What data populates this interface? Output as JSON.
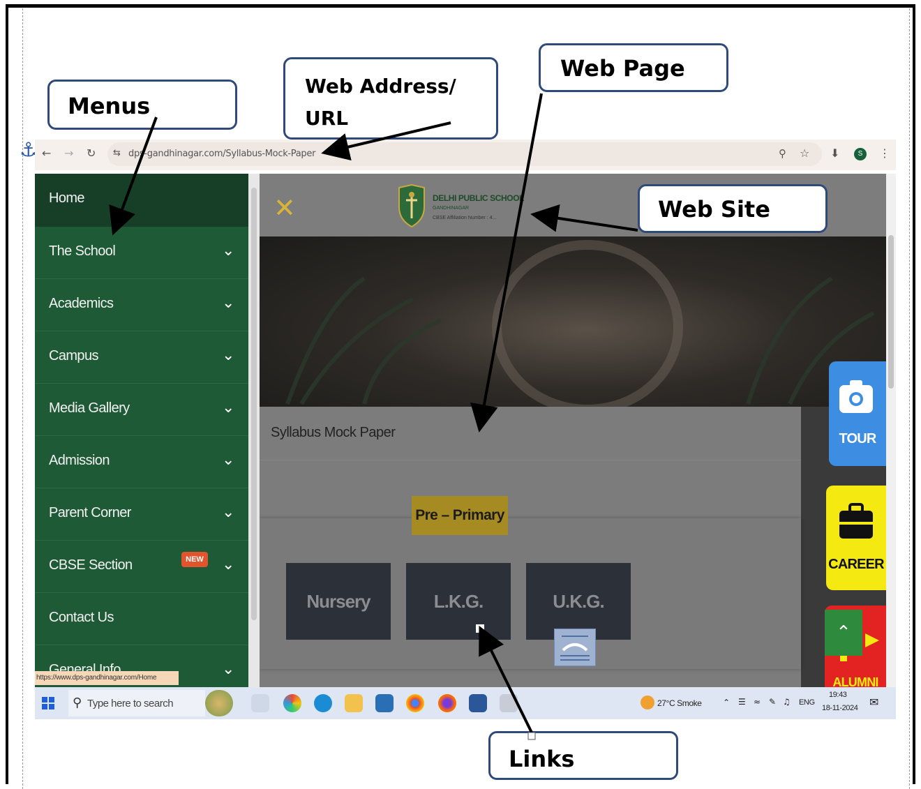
{
  "callouts": {
    "menus": "Menus",
    "web_address_line1": "Web Address/",
    "web_address_line2": "URL",
    "web_page": "Web Page",
    "web_site": "Web Site",
    "links": "Links"
  },
  "browser": {
    "url": "dps-gandhinagar.com/Syllabus-Mock-Paper",
    "status_url": "https://www.dps-gandhinagar.com/Home",
    "profile_initial": "S"
  },
  "sidebar": {
    "items": [
      {
        "label": "Home",
        "has_chevron": false
      },
      {
        "label": "The School",
        "has_chevron": true
      },
      {
        "label": "Academics",
        "has_chevron": true
      },
      {
        "label": "Campus",
        "has_chevron": true
      },
      {
        "label": "Media Gallery",
        "has_chevron": true
      },
      {
        "label": "Admission",
        "has_chevron": true
      },
      {
        "label": "Parent Corner",
        "has_chevron": true
      },
      {
        "label": "CBSE Section",
        "has_chevron": true,
        "badge": "NEW"
      },
      {
        "label": "Contact Us",
        "has_chevron": false
      },
      {
        "label": "General Info",
        "has_chevron": true
      }
    ]
  },
  "site": {
    "school_name": "DELHI PUBLIC SCHOOL",
    "school_sub": "GANDHINAGAR",
    "affiliation": "CBSE Affiliation Number : 4...",
    "page_title": "Syllabus Mock Paper",
    "category": "Pre – Primary",
    "classes": [
      "Nursery",
      "L.K.G.",
      "U.K.G."
    ],
    "accent_color": "#a68a22",
    "header_close_color": "#d7b43a"
  },
  "widgets": {
    "tour": "TOUR",
    "career": "CAREER",
    "alumni": "ALUMNI"
  },
  "taskbar": {
    "search_placeholder": "Type here to search",
    "weather": "27°C  Smoke",
    "language": "ENG",
    "time": "19:43",
    "date": "18-11-2024"
  },
  "colors": {
    "sidebar_bg": "#1f5a37",
    "sidebar_home_bg": "#173f28",
    "tour_bg": "#3d8de3",
    "career_bg": "#f4ea12",
    "alumni_bg": "#e32222",
    "callout_border": "#2f4a7a"
  }
}
